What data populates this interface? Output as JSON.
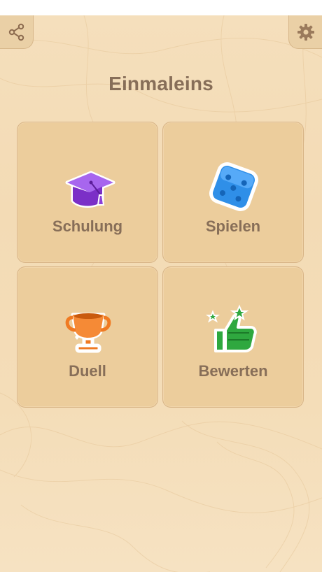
{
  "header": {
    "share_icon": "share-icon",
    "settings_icon": "gear-icon"
  },
  "title": "Einmaleins",
  "menu": [
    {
      "label": "Schulung",
      "icon": "graduation-cap-icon",
      "color": "#8b3fd8"
    },
    {
      "label": "Spielen",
      "icon": "dice-icon",
      "color": "#2f8fe8"
    },
    {
      "label": "Duell",
      "icon": "trophy-icon",
      "color": "#f07a22"
    },
    {
      "label": "Bewerten",
      "icon": "thumbs-up-icon",
      "color": "#2fa83f"
    }
  ],
  "colors": {
    "background": "#f4ddb8",
    "tile": "#eccd9c",
    "text": "#876e58"
  }
}
